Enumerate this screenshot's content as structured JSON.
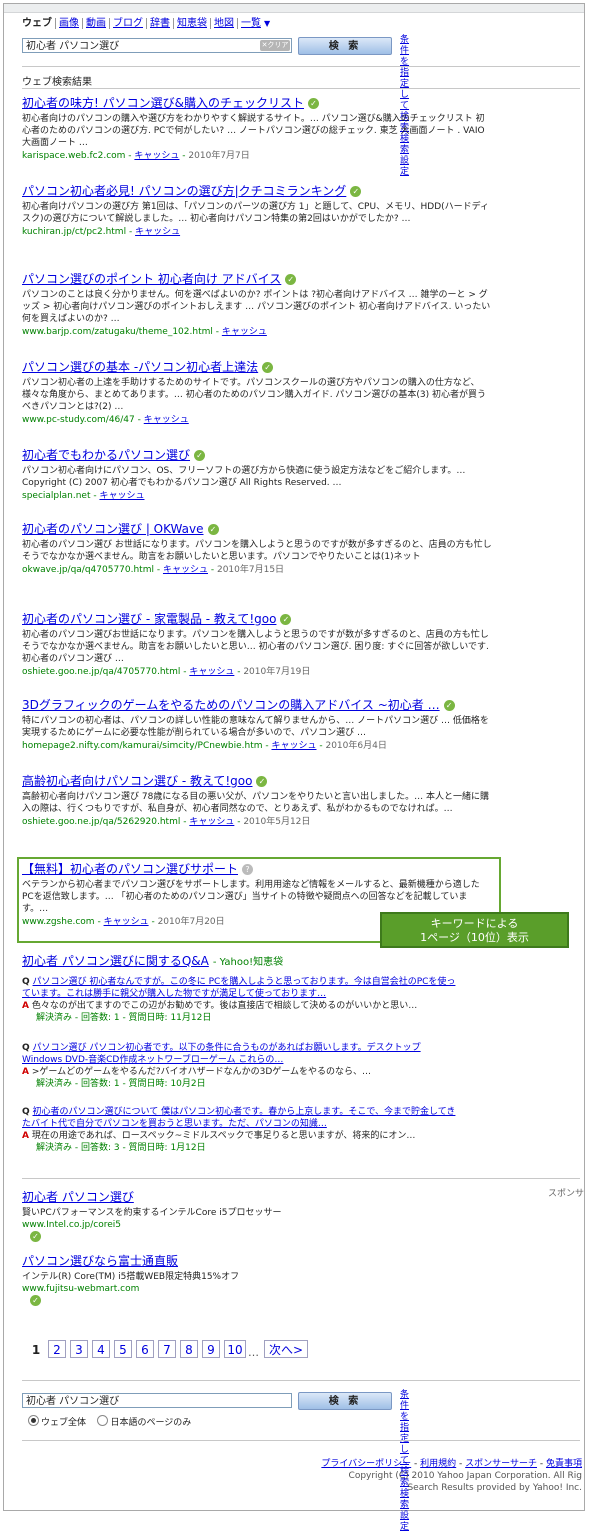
{
  "tabs": [
    {
      "label": "ウェブ"
    },
    {
      "label": "画像"
    },
    {
      "label": "動画"
    },
    {
      "label": "ブログ"
    },
    {
      "label": "辞書"
    },
    {
      "label": "知恵袋"
    },
    {
      "label": "地図"
    },
    {
      "label": "一覧"
    }
  ],
  "search": {
    "query": "初心者 パソコン選び",
    "clear_label": "✕クリア",
    "button_label": "検 索",
    "advanced_link": "条件を指定して検索",
    "settings_link": "検索設定"
  },
  "results_header": "ウェブ検索結果",
  "results": [
    {
      "title": "初心者の味方! パソコン選び&購入のチェックリスト",
      "snippet": "初心者向けのパソコンの購入や選び方をわかりやすく解説するサイト。… パソコン選び&購入のチェックリスト 初心者のためのパソコンの選び方. PCで何がしたい? … ノートパソコン選びの総チェック. 東芝 大画面ノート . VAIO 大画面ノート …",
      "url": "karispace.web.fc2.com",
      "cache": "キャッシュ",
      "date": "2010年7月7日"
    },
    {
      "title": "パソコン初心者必見! パソコンの選び方|クチコミランキング",
      "snippet": "初心者向けパソコンの選び方 第1回は、「パソコンのパーツの選び方 1」と題して、CPU、メモリ、HDD(ハードディスク)の選び方について解説しました。… 初心者向けパソコン特集の第2回はいかがでしたか? …",
      "url": "kuchiran.jp/ct/pc2.html",
      "cache": "キャッシュ",
      "date": ""
    },
    {
      "title": "パソコン選びのポイント 初心者向け アドバイス",
      "snippet": "パソコンのことは良く分かりません。何を選べばよいのか? ポイントは ?初心者向けアドバイス … 雑学のーと > グッズ > 初心者向けパソコン選びのポイントおしえます … パソコン選びのポイント 初心者向けアドバイス. いったい何を買えばよいのか? …",
      "url": "www.barjp.com/zatugaku/theme_102.html",
      "cache": "キャッシュ",
      "date": ""
    },
    {
      "title": "パソコン選びの基本 -パソコン初心者上達法",
      "snippet": "パソコン初心者の上達を手助けするためのサイトです。パソコンスクールの選び方やパソコンの購入の仕方など、様々な角度から、まとめてあります。… 初心者のためのパソコン購入ガイド. パソコン選びの基本(3) 初心者が買うべきパソコンとは?(2) …",
      "url": "www.pc-study.com/46/47",
      "cache": "キャッシュ",
      "date": ""
    },
    {
      "title": "初心者でもわかるパソコン選び",
      "snippet": "パソコン初心者向けにパソコン、OS、フリーソフトの選び方から快適に使う設定方法などをご紹介します。… Copyright (C) 2007 初心者でもわかるパソコン選び All Rights Reserved. …",
      "url": "specialplan.net",
      "cache": "キャッシュ",
      "date": ""
    },
    {
      "title": "初心者のパソコン選び | OKWave",
      "snippet": "初心者のパソコン選び お世話になります。パソコンを購入しようと思うのですが数が多すぎるのと、店員の方も忙しそうでなかなか選べません。助言をお願いしたいと思います。パソコンでやりたいことは(1)ネット",
      "url": "okwave.jp/qa/q4705770.html",
      "cache": "キャッシュ",
      "date": "2010年7月15日"
    },
    {
      "title": "初心者のパソコン選び - 家電製品 - 教えて!goo",
      "snippet": "初心者のパソコン選びお世話になります。パソコンを購入しようと思うのですが数が多すぎるのと、店員の方も忙しそうでなかなか選べません。助言をお願いしたいと思い… 初心者のパソコン選び. 困り度: すぐに回答が欲しいです. 初心者のパソコン選び …",
      "url": "oshiete.goo.ne.jp/qa/4705770.html",
      "cache": "キャッシュ",
      "date": "2010年7月19日"
    },
    {
      "title": "3Dグラフィックのゲームをやるためのパソコンの購入アドバイス ~初心者 …",
      "snippet": "特にパソコンの初心者は、パソコンの詳しい性能の意味なんて解りませんから、… ノートパソコン選び … 低価格を実現するためにゲームに必要な性能が削られている場合が多いので、パソコン選び …",
      "url": "homepage2.nifty.com/kamurai/simcity/PCnewbie.htm",
      "cache": "キャッシュ",
      "date": "2010年6月4日"
    },
    {
      "title": "高齢初心者向けパソコン選び - 教えて!goo",
      "snippet": "高齢初心者向けパソコン選び 78歳になる目の悪い父が、パソコンをやりたいと言い出しました。… 本人と一緒に購入の際は、行くつもりですが、私自身が、初心者同然なので、とりあえず、私がわかるものでなければ。…",
      "url": "oshiete.goo.ne.jp/qa/5262920.html",
      "cache": "キャッシュ",
      "date": "2010年5月12日"
    },
    {
      "title": "【無料】初心者のパソコン選びサポート",
      "snippet": "ベテランから初心者までパソコン選びをサポートします。利用用途など情報をメールすると、最新機種から適したPCを返信致します。… 「初心者のためのパソコン選び」当サイトの特徴や疑問点への回答などを記載しています。…",
      "url": "www.zgshe.com",
      "cache": "キャッシュ",
      "date": "2010年7月20日"
    }
  ],
  "callout": {
    "line1": "キーワードによる",
    "line2": "1ページ（10位）表示"
  },
  "qa_section": {
    "title": "初心者 パソコン選び",
    "title_suffix": "に関するQ&A",
    "source": "- Yahoo!知恵袋",
    "items": [
      {
        "q": "パソコン選び 初心者なんですが。この冬に PCを購入しようと思っております。今は自営会社のPCを使っています。これは勝手に親父が購入した物ですが満足して使っております…",
        "a": "色々なのが出てますのでこの辺がお勧めです。後は直接店で相談して決めるのがいいかと思い…",
        "status": "解決済み - 回答数: 1 - 質問日時: 11月12日"
      },
      {
        "q": "パソコン選び パソコン初心者です。以下の条件に合うものがあればお願いします。デスクトップ Windows DVD-音楽CD作成ネットワーブローゲーム これらの…",
        "a": ">ゲームどのゲームをやるんだ?バイオハザードなんかの3Dゲームをやるのなら、…",
        "status": "解決済み - 回答数: 1 - 質問日時: 10月2日"
      },
      {
        "q": "初心者のパソコン選びについて 僕はパソコン初心者です。春から上京します。そこで、今まで貯金してきたバイト代で自分でパソコンを買おうと思います。ただ、パソコンの知識…",
        "a": "現在の用途であれば、ロースペック~ミドルスペックで事足りると思いますが、将来的にオン…",
        "status": "解決済み - 回答数: 3 - 質問日時: 1月12日"
      }
    ]
  },
  "sponsor_label": "スポンサ",
  "ads": [
    {
      "title": "初心者 パソコン選び",
      "desc": "賢いPCパフォーマンスを約束するインテルCore i5プロセッサー",
      "url": "www.Intel.co.jp/corei5"
    },
    {
      "title": "パソコン選びなら富士通直販",
      "desc": "インテル(R) Core(TM) i5搭載WEB限定特典15%オフ",
      "url": "www.fujitsu-webmart.com"
    }
  ],
  "pagination": {
    "current": "1",
    "pages": [
      "2",
      "3",
      "4",
      "5",
      "6",
      "7",
      "8",
      "9",
      "10"
    ],
    "dots": "…",
    "next": "次へ>"
  },
  "footer_search": {
    "query": "初心者 パソコン選び",
    "button_label": "検 索",
    "advanced_link": "条件を指定して検索",
    "settings_link": "検索設定",
    "radio_all": "ウェブ全体",
    "radio_ja": "日本語のページのみ"
  },
  "footer": {
    "links": [
      "プライバシーポリシー",
      "利用規約",
      "スポンサーサーチ",
      "免責事項"
    ],
    "copyright": "Copyright (C) 2010 Yahoo Japan Corporation. All Rig",
    "provided": "Search Results provided by Yahoo! Inc."
  }
}
